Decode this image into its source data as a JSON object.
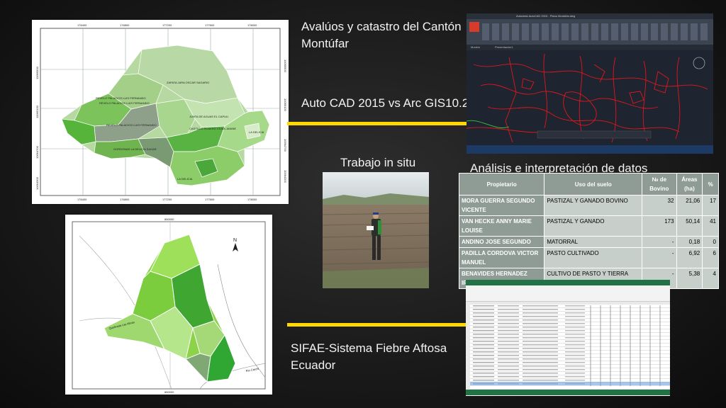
{
  "titles": {
    "catastro_line1": "Avalúos y catastro del Cantón",
    "catastro_line2": "Montúfar",
    "cad_vs_gis": "Auto CAD 2015 vs Arc GIS10.2",
    "trabajo": "Trabajo in situ",
    "analisis": "Análisis e interpretación de datos",
    "sifae_line1": "SIFAE-Sistema Fiebre  Aftosa",
    "sifae_line2": "Ecuador"
  },
  "map1": {
    "top_ticks": [
      "176400",
      "176800",
      "177200",
      "177600",
      "178000"
    ],
    "bottom_ticks": [
      "176400",
      "176800",
      "177200",
      "177600",
      "178000"
    ],
    "left_ticks": [
      "10065500",
      "10065100",
      "10064700",
      "10064300"
    ],
    "right_ticks": [
      "10065500",
      "10065100",
      "10064700",
      "10064300"
    ],
    "labels": [
      "ZAPATA JARA OSCAR SAGARIO",
      "REVELO PALACIOS LUIS FERNANDO",
      "REVELO PALACIOS LUIS FERNANDO",
      "REVELO PALACIOS LUIS FERNANDO",
      "JUNTA DE AGUAS EL CAPULI",
      "CASTILLO ROSERO VILMA JANINE",
      "LA DELICIA",
      "LA DELICIA",
      "GORDONAS LA DELICIA SAGAR"
    ]
  },
  "map2": {
    "top_tick": "850000",
    "bottom_tick": "850000",
    "north": "N",
    "road_label": "Quebrada Las Minas",
    "river_label": "Rio Carchi"
  },
  "cad": {
    "title": "Autodesk AutoCAD 2015 - Plano Montúfar.dwg",
    "tab_model": "Modelo",
    "tab_layout": "Presentación1"
  },
  "table": {
    "headers": [
      "Propietario",
      "Uso del suelo",
      "№ de Bovino",
      "Áreas (ha)",
      "%"
    ],
    "rows": [
      {
        "owner": "MORA GUERRA SEGUNDO VICENTE",
        "use": "PASTIZAL Y GANADO BOVINO",
        "bovinos": "32",
        "area": "21,06",
        "pct": "17"
      },
      {
        "owner": "VAN HECKE ANNY MARIE LOUISE",
        "use": "PASTIZAL Y GANADO",
        "bovinos": "173",
        "area": "50,14",
        "pct": "41"
      },
      {
        "owner": "ANDINO JOSE SEGUNDO",
        "use": "MATORRAL",
        "bovinos": "-",
        "area": "0,18",
        "pct": "0"
      },
      {
        "owner": "PADILLA CORDOVA VICTOR MANUEL",
        "use": "PASTO CULTIVADO",
        "bovinos": "-",
        "area": "6,92",
        "pct": "6"
      },
      {
        "owner": "BENAVIDES HERNADEZ IRMA ANTONIETA",
        "use": "CULTIVO DE PASTO Y TIERRA PREPARADA PARA SIEMBRA",
        "bovinos": "-",
        "area": "5,38",
        "pct": "4"
      }
    ]
  },
  "colors": {
    "accent_line": "#ffd800",
    "table_header": "#8f9b95",
    "table_cell": "#c6cfca",
    "cad_lines": "#e0181c"
  }
}
